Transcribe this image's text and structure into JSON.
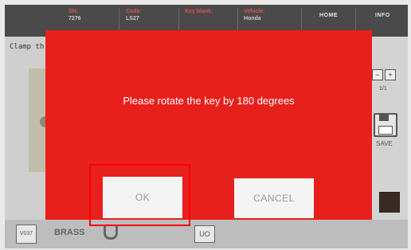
{
  "header": {
    "fields": [
      {
        "label": "SN:",
        "value": "7276"
      },
      {
        "label": "Code:",
        "value": "LS27"
      },
      {
        "label": "Key blank:",
        "value": ""
      },
      {
        "label": "Vehicle:",
        "value": "Honda"
      }
    ],
    "home_label": "HOME",
    "info_label": "INFO"
  },
  "instruction": "Clamp th",
  "right_panel": {
    "page": "1/1",
    "save_label": "SAVE"
  },
  "bottom": {
    "tag_label": "V037",
    "material": "BRASS",
    "profile_label": "UO"
  },
  "dialog": {
    "message": "Please rotate the key by 180 degrees",
    "ok_label": "OK",
    "cancel_label": "CANCEL",
    "background_color": "#e8201c"
  }
}
